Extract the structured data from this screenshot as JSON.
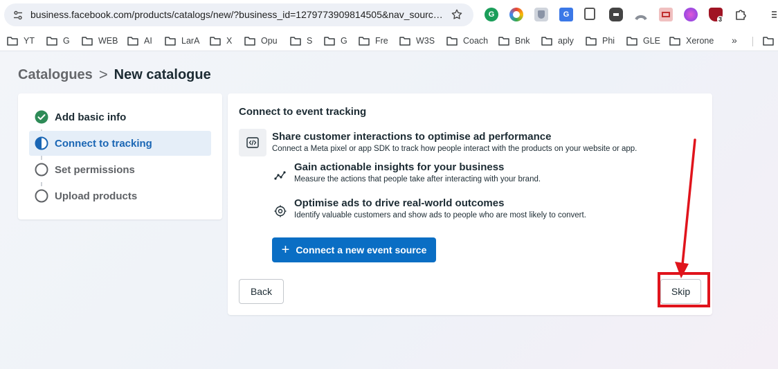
{
  "browser": {
    "url": "business.facebook.com/products/catalogs/new/?business_id=1279773909814505&nav_source...",
    "extension_badge": "3",
    "bookmarks": [
      "YT",
      "G",
      "WEB",
      "AI",
      "LarA",
      "X",
      "Opu",
      "S",
      "G",
      "Fre",
      "W3S",
      "Coach",
      "Bnk",
      "aply",
      "Phi",
      "GLE",
      "Xerone"
    ],
    "bookmarks_more": "»"
  },
  "breadcrumb": {
    "parent": "Catalogues",
    "separator": ">",
    "current": "New catalogue"
  },
  "steps": [
    {
      "label": "Add basic info",
      "state": "done"
    },
    {
      "label": "Connect to tracking",
      "state": "active"
    },
    {
      "label": "Set permissions",
      "state": "pending"
    },
    {
      "label": "Upload products",
      "state": "pending"
    }
  ],
  "main": {
    "title": "Connect to event tracking",
    "features": [
      {
        "heading": "Share customer interactions to optimise ad performance",
        "description": "Connect a Meta pixel or app SDK to track how people interact with the products on your website or app.",
        "icon": "code-icon"
      },
      {
        "heading": "Gain actionable insights for your business",
        "description": "Measure the actions that people take after interacting with your brand.",
        "icon": "insights-icon"
      },
      {
        "heading": "Optimise ads to drive real-world outcomes",
        "description": "Identify valuable customers and show ads to people who are most likely to convert.",
        "icon": "target-icon"
      }
    ],
    "connect_button": "Connect a new event source",
    "back_button": "Back",
    "skip_button": "Skip"
  },
  "colors": {
    "primary": "#0a6ec4",
    "active_step_bg": "#e5eef8",
    "done_green": "#2e8b57",
    "annotation_red": "#e0141c"
  }
}
